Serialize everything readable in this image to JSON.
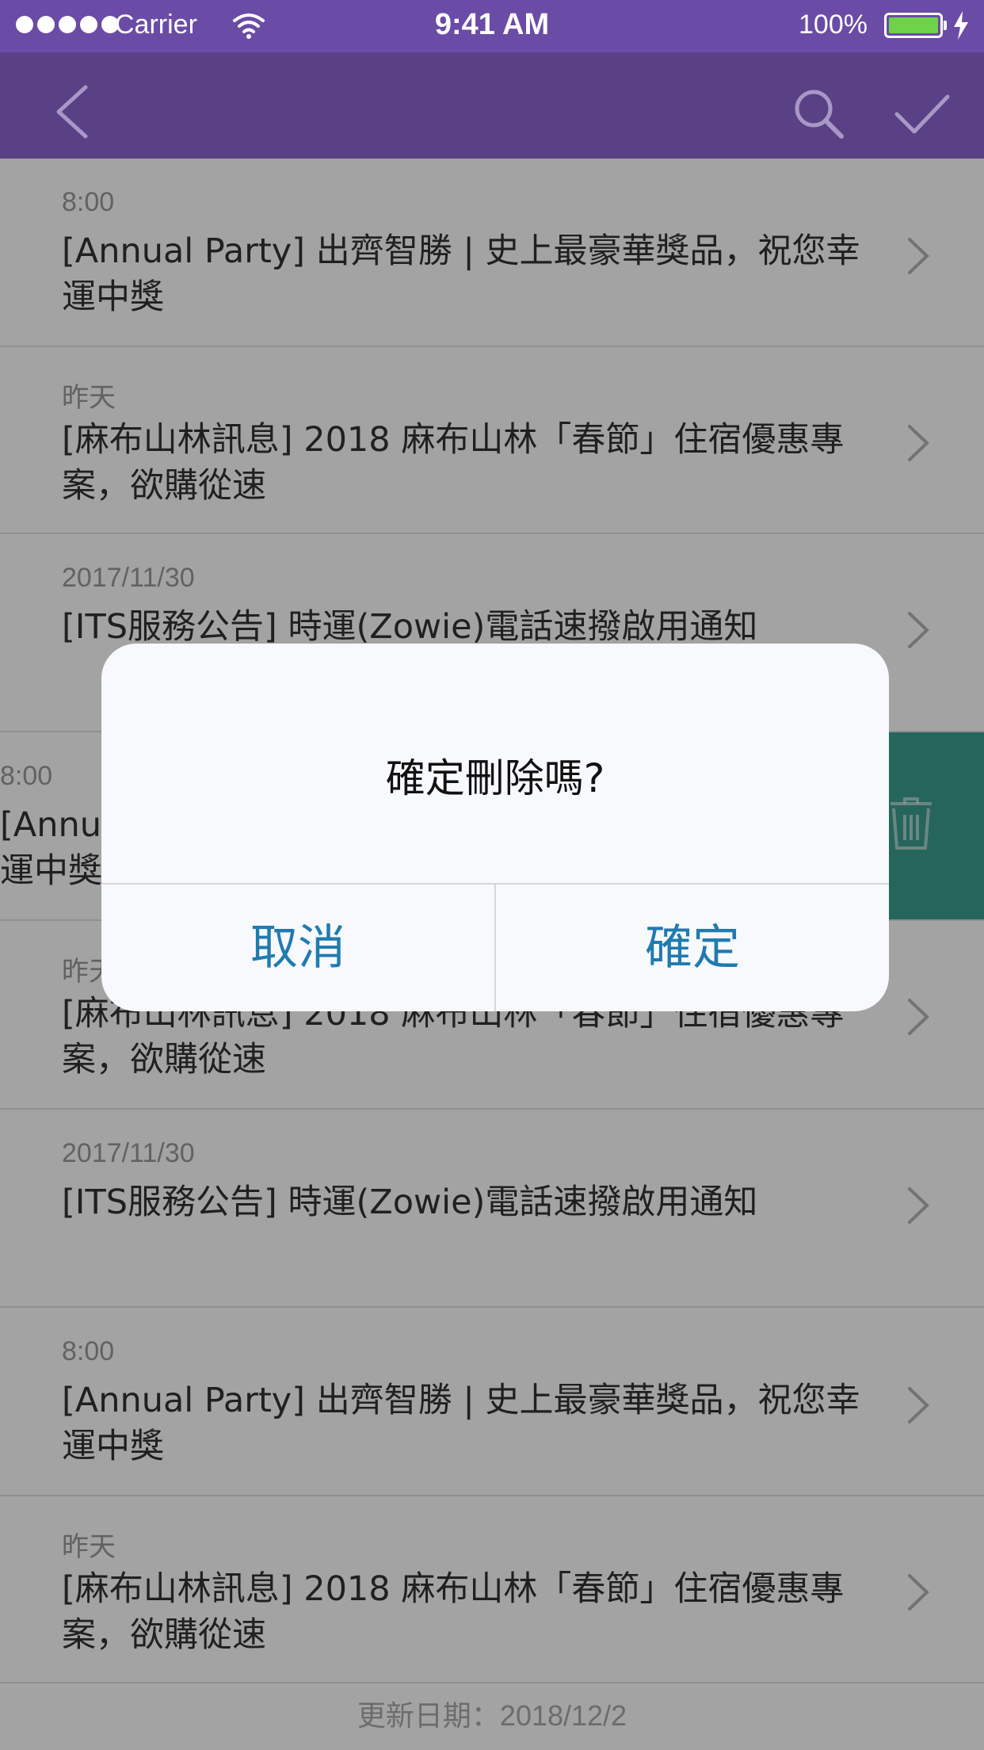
{
  "status_bar": {
    "carrier": "Carrier",
    "time": "9:41 AM",
    "battery_percent": "100%",
    "signal_dots": 5,
    "battery_level": 1.0
  },
  "nav": {
    "back_icon": "chevron-left-icon",
    "search_icon": "search-icon",
    "confirm_icon": "checkmark-icon"
  },
  "items": [
    {
      "date": "8:00",
      "title": "[Annual Party] 出齊智勝 | 史上最豪華獎品，祝您幸運中獎"
    },
    {
      "date": "昨天",
      "title": "[麻布山林訊息] 2018 麻布山林「春節」住宿優惠專案，欲購從速"
    },
    {
      "date": "2017/11/30",
      "title": "[ITS服務公告] 時運(Zowie)電話速撥啟用通知"
    },
    {
      "date": "8:00",
      "title": "[Annual Party] 出齊智勝 | 史上最豪華獎品，祝您幸運中獎"
    },
    {
      "date": "昨天",
      "title": "[麻布山林訊息] 2018 麻布山林「春節」住宿優惠專案，欲購從速"
    },
    {
      "date": "2017/11/30",
      "title": "[ITS服務公告] 時運(Zowie)電話速撥啟用通知"
    },
    {
      "date": "8:00",
      "title": "[Annual Party] 出齊智勝 | 史上最豪華獎品，祝您幸運中獎"
    },
    {
      "date": "昨天",
      "title": "[麻布山林訊息] 2018 麻布山林「春節」住宿優惠專案，欲購從速"
    }
  ],
  "footer": {
    "updated": "更新日期：2018/12/2"
  },
  "dialog": {
    "message": "確定刪除嗎?",
    "cancel_label": "取消",
    "confirm_label": "確定"
  },
  "colors": {
    "status_bar": "#6a4ca6",
    "nav_bar": "#5a4186",
    "delete_action": "#3c9e8f",
    "dialog_button_text": "#1f7bb0"
  }
}
